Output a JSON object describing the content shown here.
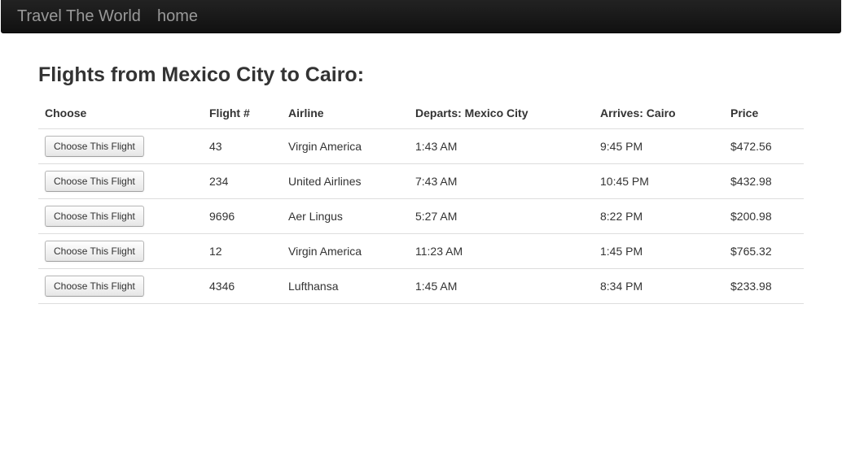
{
  "navbar": {
    "brand": "Travel The World",
    "home_link": "home"
  },
  "page": {
    "title": "Flights from Mexico City to Cairo:"
  },
  "table": {
    "headers": {
      "choose": "Choose",
      "flight": "Flight #",
      "airline": "Airline",
      "departs": "Departs: Mexico City",
      "arrives": "Arrives: Cairo",
      "price": "Price"
    },
    "button_label": "Choose This Flight",
    "rows": [
      {
        "flight": "43",
        "airline": "Virgin America",
        "departs": "1:43 AM",
        "arrives": "9:45 PM",
        "price": "$472.56"
      },
      {
        "flight": "234",
        "airline": "United Airlines",
        "departs": "7:43 AM",
        "arrives": "10:45 PM",
        "price": "$432.98"
      },
      {
        "flight": "9696",
        "airline": "Aer Lingus",
        "departs": "5:27 AM",
        "arrives": "8:22 PM",
        "price": "$200.98"
      },
      {
        "flight": "12",
        "airline": "Virgin America",
        "departs": "11:23 AM",
        "arrives": "1:45 PM",
        "price": "$765.32"
      },
      {
        "flight": "4346",
        "airline": "Lufthansa",
        "departs": "1:45 AM",
        "arrives": "8:34 PM",
        "price": "$233.98"
      }
    ]
  }
}
